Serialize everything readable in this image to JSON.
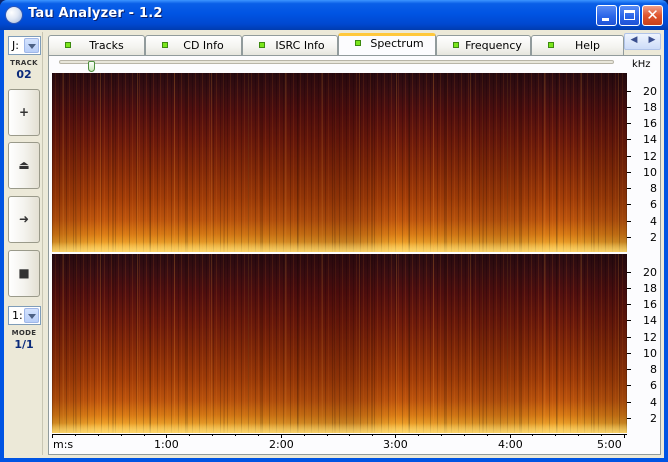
{
  "window": {
    "title": "Tau Analyzer - 1.2",
    "close_glyph": "✕"
  },
  "left_toolbar": {
    "drive_value": "J:",
    "track_caption": "TRACK",
    "track_number": "02",
    "buttons": [
      {
        "name": "zoom-in-button",
        "icon": "plus-icon",
        "glyph": "+"
      },
      {
        "name": "eject-button",
        "icon": "eject-icon",
        "glyph": "⏏"
      },
      {
        "name": "play-button",
        "icon": "arrow-right-icon",
        "glyph": "➜"
      },
      {
        "name": "stop-button",
        "icon": "stop-icon",
        "glyph": "■"
      }
    ],
    "mode_value": "1:",
    "mode_caption": "MODE",
    "mode_number": "1/1"
  },
  "tabs": [
    {
      "label": "Tracks",
      "active": false
    },
    {
      "label": "CD Info",
      "active": false
    },
    {
      "label": "ISRC Info",
      "active": false
    },
    {
      "label": "Spectrum",
      "active": true
    },
    {
      "label": "Frequency",
      "active": false
    },
    {
      "label": "Help",
      "active": false
    }
  ],
  "spectrum": {
    "freq_unit": "kHz",
    "position_fraction": 0.05,
    "freq_ticks": [
      "20",
      "18",
      "16",
      "14",
      "12",
      "10",
      "8",
      "6",
      "4",
      "2"
    ],
    "freq_range_khz": [
      0,
      22.05
    ],
    "time_axis_label": "m:s",
    "time_ticks": [
      "1:00",
      "2:00",
      "3:00",
      "4:00",
      "5:00"
    ],
    "time_range_seconds": [
      0,
      300
    ],
    "channels": [
      "top",
      "bottom"
    ]
  },
  "colors": {
    "titlebar": "#0054e3",
    "spectrum_low": "#280a10",
    "spectrum_high": "#fbd05a",
    "active_tab_accent": "#ffc83c",
    "tab_led": "#7be61c"
  }
}
